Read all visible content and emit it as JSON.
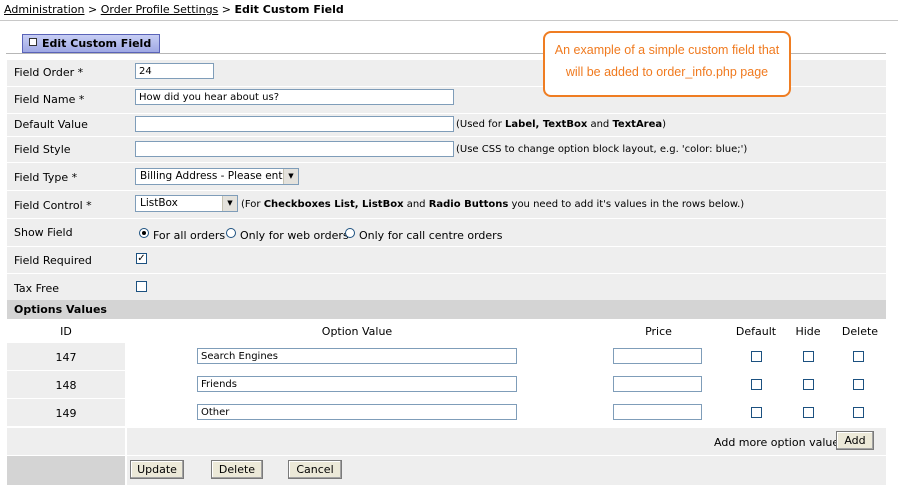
{
  "breadcrumb": {
    "link1": "Administration",
    "sep1": " > ",
    "link2": "Order Profile Settings",
    "sep2": " > ",
    "current": "Edit Custom Field"
  },
  "section_title": "Edit Custom Field",
  "note": {
    "line1": "An example of a simple custom field that",
    "line2": "will be added to order_info.php page"
  },
  "form": {
    "field_order": {
      "label": "Field Order *",
      "value": "24"
    },
    "field_name": {
      "label": "Field Name *",
      "value": "How did you hear about us?"
    },
    "default_value": {
      "label": "Default Value",
      "value": "",
      "hint_pre": "(Used for ",
      "hint_b1": "Label, TextBox",
      "hint_mid": " and ",
      "hint_b2": "TextArea",
      "hint_post": ")"
    },
    "field_style": {
      "label": "Field Style",
      "value": "",
      "hint": "(Use CSS to change option block layout, e.g. 'color: blue;')"
    },
    "field_type": {
      "label": "Field Type *",
      "selected": "Billing Address - Please enter"
    },
    "field_control": {
      "label": "Field Control *",
      "selected": "ListBox",
      "hint_pre": "(For ",
      "hint_b1": "Checkboxes List, ListBox",
      "hint_mid": " and ",
      "hint_b2": "Radio Buttons",
      "hint_post": " you need to add it's values in the rows below.)"
    },
    "show_field": {
      "label": "Show Field",
      "options": [
        "For all orders",
        "Only for web orders",
        "Only for call centre orders"
      ],
      "selected": 0
    },
    "field_required": {
      "label": "Field Required",
      "checked": true,
      "mark": "✓"
    },
    "tax_free": {
      "label": "Tax Free",
      "checked": false
    }
  },
  "options": {
    "title": "Options Values",
    "columns": {
      "id": "ID",
      "option_value": "Option Value",
      "price": "Price",
      "default": "Default",
      "hide": "Hide",
      "delete": "Delete"
    },
    "rows": [
      {
        "id": "147",
        "value": "Search Engines",
        "price": ""
      },
      {
        "id": "148",
        "value": "Friends",
        "price": ""
      },
      {
        "id": "149",
        "value": "Other",
        "price": ""
      }
    ],
    "add_more_label": "Add more option values?",
    "add_button": "Add"
  },
  "buttons": {
    "update": "Update",
    "delete": "Delete",
    "cancel": "Cancel"
  }
}
